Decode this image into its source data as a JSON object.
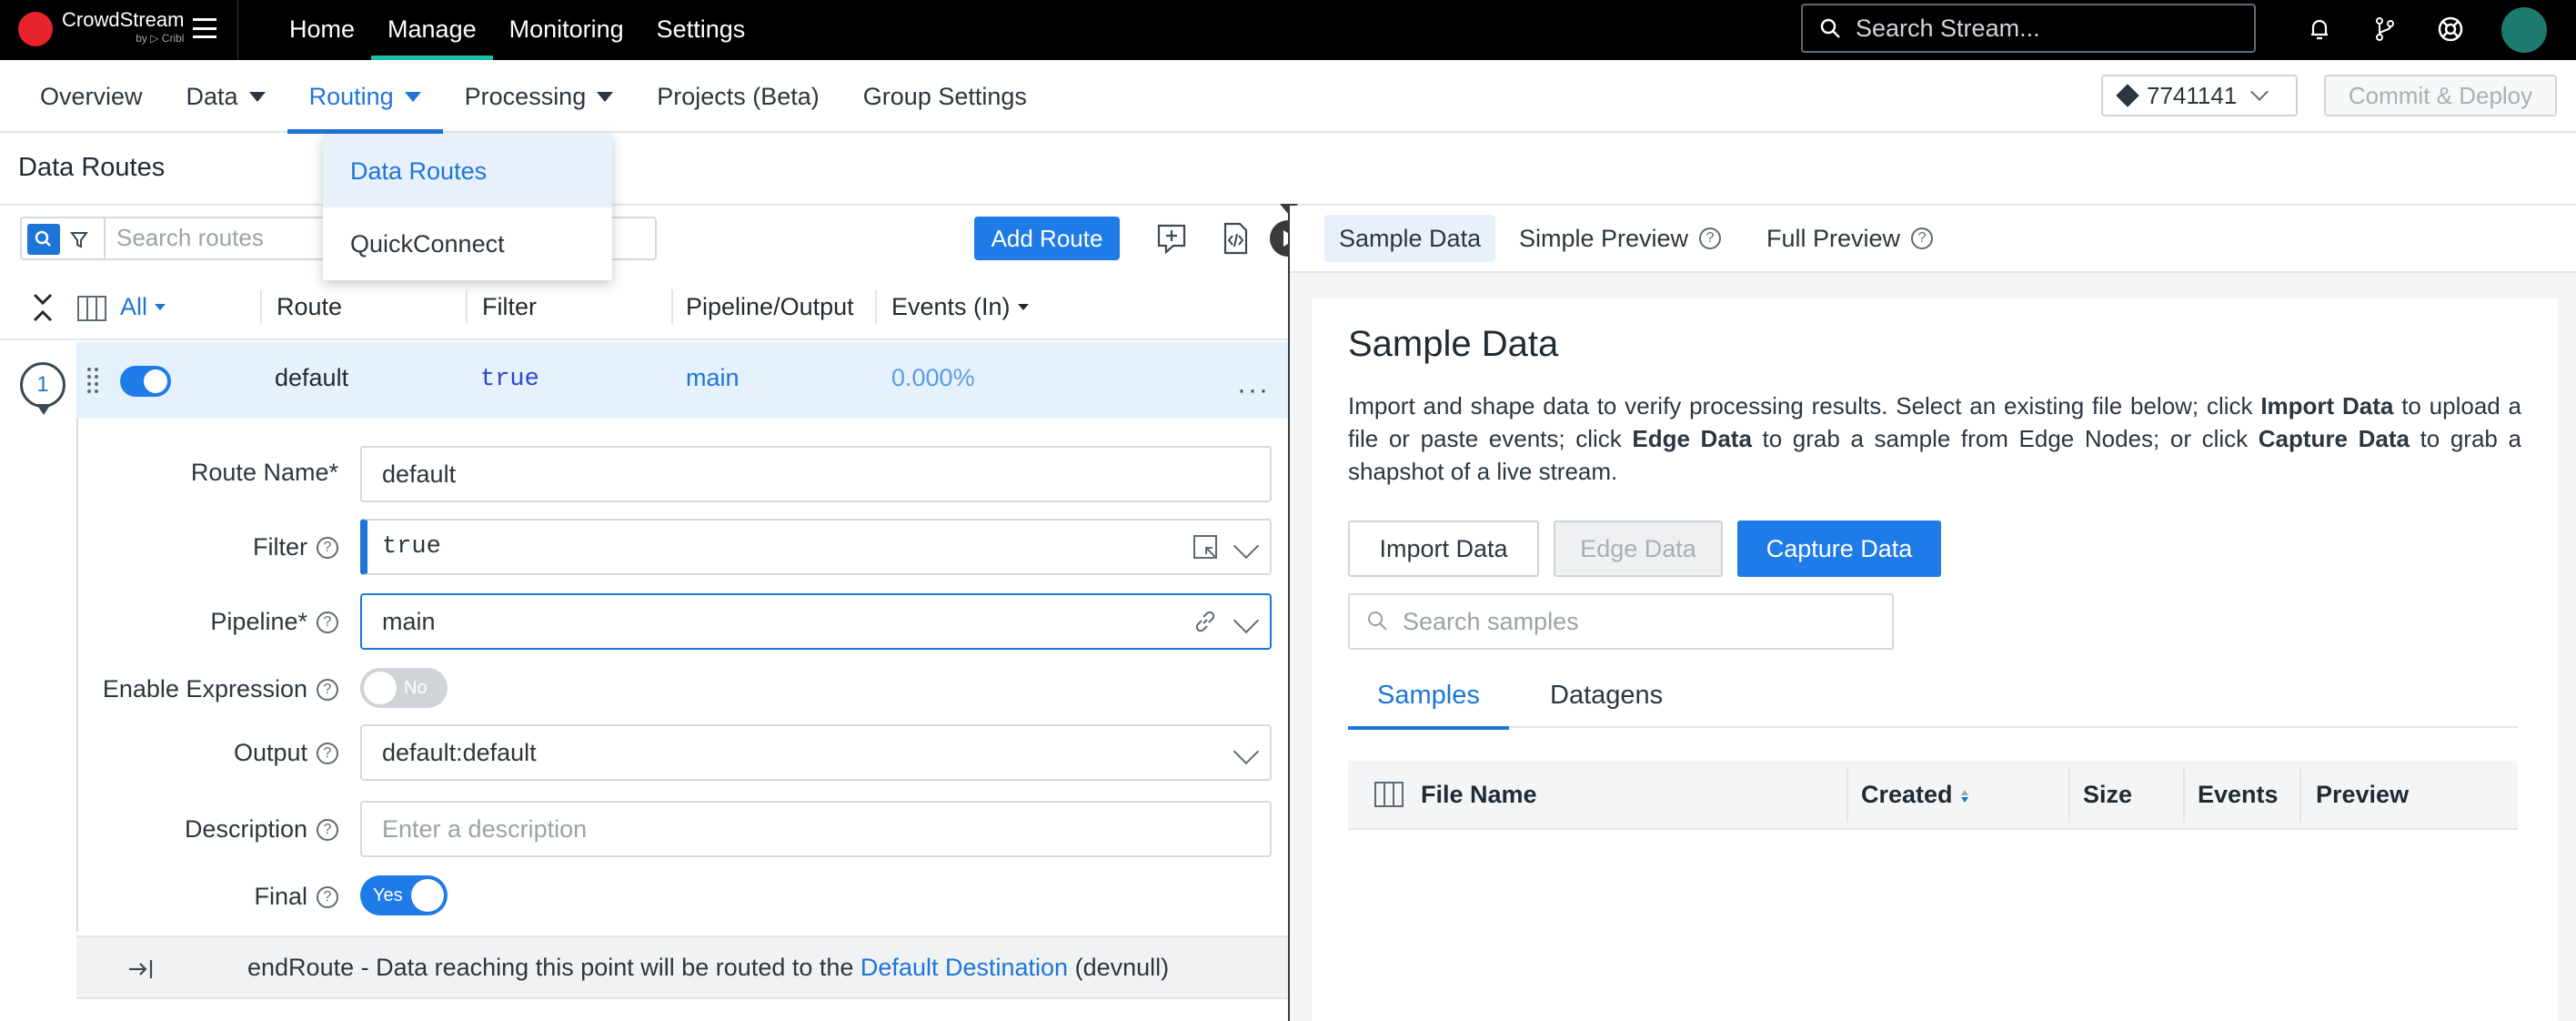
{
  "topbar": {
    "logo": {
      "name": "CrowdStream",
      "sub": "by ▷ Cribl"
    },
    "nav": [
      "Home",
      "Manage",
      "Monitoring",
      "Settings"
    ],
    "search_placeholder": "Search Stream..."
  },
  "subnav": {
    "items": [
      "Overview",
      "Data",
      "Routing",
      "Processing",
      "Projects (Beta)",
      "Group Settings"
    ],
    "commit_id": "7741141",
    "commit_button": "Commit & Deploy"
  },
  "routing_menu": [
    "Data Routes",
    "QuickConnect"
  ],
  "page_title": "Data Routes",
  "routes": {
    "search_placeholder": "Search routes",
    "add_button": "Add Route",
    "columns": [
      "All",
      "Route",
      "Filter",
      "Pipeline/Output",
      "Events (In)"
    ],
    "row": {
      "number": "1",
      "name": "default",
      "filter": "true",
      "pipeline": "main",
      "events": "0.000%"
    }
  },
  "form": {
    "route_name_label": "Route Name*",
    "route_name_value": "default",
    "filter_label": "Filter",
    "filter_value": "true",
    "pipeline_label": "Pipeline*",
    "pipeline_value": "main",
    "enable_expression_label": "Enable Expression",
    "enable_expression_state": "No",
    "output_label": "Output",
    "output_value": "default:default",
    "description_label": "Description",
    "description_placeholder": "Enter a description",
    "final_label": "Final",
    "final_state": "Yes"
  },
  "end_route": {
    "text": "endRoute - Data reaching this point will be routed to the",
    "link": "Default Destination",
    "suffix": "(devnull)"
  },
  "preview": {
    "tabs": [
      "Sample Data",
      "Simple Preview",
      "Full Preview"
    ],
    "title": "Sample Data",
    "desc_1": "Import and shape data to verify processing results. Select an existing file below; click",
    "desc_import": "Import Data",
    "desc_2": "to upload a file or paste events; click",
    "desc_edge": "Edge Data",
    "desc_3": "to grab a sample from Edge Nodes; or click",
    "desc_capture": "Capture Data",
    "desc_4": "to grab a shapshot of a live stream.",
    "buttons": [
      "Import Data",
      "Edge Data",
      "Capture Data"
    ],
    "search_placeholder": "Search samples",
    "sample_tabs": [
      "Samples",
      "Datagens"
    ],
    "columns": [
      "File Name",
      "Created",
      "Size",
      "Events",
      "Preview"
    ]
  }
}
